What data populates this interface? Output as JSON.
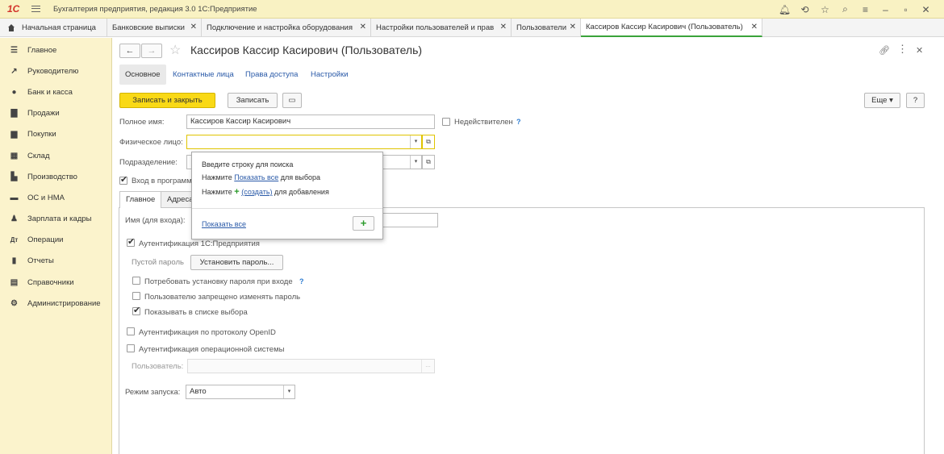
{
  "app": {
    "title": "Бухгалтерия предприятия, редакция 3.0 1С:Предприятие",
    "logo": "1С"
  },
  "tabs": [
    {
      "label": "Начальная страница"
    },
    {
      "label": "Банковские выписки"
    },
    {
      "label": "Подключение и настройка оборудования"
    },
    {
      "label": "Настройки пользователей и прав"
    },
    {
      "label": "Пользователи"
    },
    {
      "label": "Кассиров Кассир Касирович (Пользователь)"
    }
  ],
  "sidebar": {
    "items": [
      {
        "label": "Главное",
        "icon": "menu-icon"
      },
      {
        "label": "Руководителю",
        "icon": "trend-icon"
      },
      {
        "label": "Банк и касса",
        "icon": "coin-icon"
      },
      {
        "label": "Продажи",
        "icon": "bag-icon"
      },
      {
        "label": "Покупки",
        "icon": "cart-icon"
      },
      {
        "label": "Склад",
        "icon": "warehouse-icon"
      },
      {
        "label": "Производство",
        "icon": "factory-icon"
      },
      {
        "label": "ОС и НМА",
        "icon": "truck-icon"
      },
      {
        "label": "Зарплата и кадры",
        "icon": "person-icon"
      },
      {
        "label": "Операции",
        "icon": "operations-icon"
      },
      {
        "label": "Отчеты",
        "icon": "chart-icon"
      },
      {
        "label": "Справочники",
        "icon": "book-icon"
      },
      {
        "label": "Администрирование",
        "icon": "gear-icon"
      }
    ]
  },
  "form": {
    "title": "Кассиров Кассир Касирович (Пользователь)",
    "subtabs": [
      "Основное",
      "Контактные лица",
      "Права доступа",
      "Настройки"
    ],
    "buttons": {
      "save_close": "Записать и закрыть",
      "save": "Записать",
      "more": "Еще",
      "help": "?"
    },
    "full_name_label": "Полное имя:",
    "full_name_value": "Кассиров Кассир Касирович",
    "inactive_label": "Недействителен",
    "person_label": "Физическое лицо:",
    "person_value": "",
    "department_label": "Подразделение:",
    "login_allowed_label": "Вход в программу разрешен",
    "inner_tabs": [
      "Главное",
      "Адреса, телефоны"
    ],
    "login_name_label": "Имя (для входа):",
    "auth_1c_label": "Аутентификация 1С:Предприятия",
    "empty_password_label": "Пустой пароль",
    "set_password_button": "Установить пароль...",
    "require_password_label": "Потребовать установку пароля при входе",
    "forbid_change_label": "Пользователю запрещено изменять пароль",
    "show_in_list_label": "Показывать в списке выбора",
    "openid_label": "Аутентификация по протоколу OpenID",
    "os_auth_label": "Аутентификация операционной системы",
    "os_user_label": "Пользователь:",
    "launch_mode_label": "Режим запуска:",
    "launch_mode_value": "Авто"
  },
  "popup": {
    "line1": "Введите строку для поиска",
    "line2_prefix": "Нажмите ",
    "line2_link": "Показать все",
    "line2_suffix": " для выбора",
    "line3_prefix": "Нажмите ",
    "line3_plus": "+",
    "line3_link": "(создать)",
    "line3_suffix": " для добавления",
    "show_all_link": "Показать все",
    "add_button": "+"
  }
}
